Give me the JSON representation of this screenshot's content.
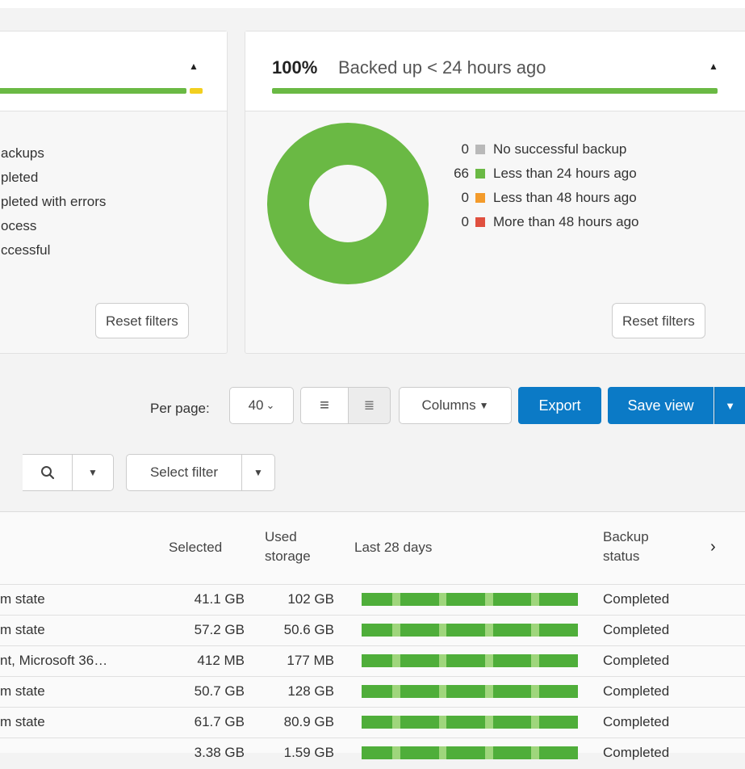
{
  "colors": {
    "green": "#6ab944",
    "yellow": "#f2cf1f",
    "gray": "#b9b9b9",
    "orange": "#f39b2b",
    "red": "#e0503f",
    "blue": "#0b7ac6"
  },
  "left_card": {
    "statuses": [
      "ackups",
      "pleted",
      "pleted with errors",
      "ocess",
      "ccessful"
    ],
    "reset_label": "Reset filters"
  },
  "right_card": {
    "percent": "100%",
    "title": "Backed up < 24 hours ago",
    "reset_label": "Reset filters",
    "donut_fraction_green": 1.0,
    "legend": [
      {
        "count": "0",
        "label": "No successful backup",
        "color": "#b9b9b9"
      },
      {
        "count": "66",
        "label": "Less than 24 hours ago",
        "color": "#6ab944"
      },
      {
        "count": "0",
        "label": "Less than 48 hours ago",
        "color": "#f39b2b"
      },
      {
        "count": "0",
        "label": "More than 48 hours ago",
        "color": "#e0503f"
      }
    ]
  },
  "toolbar": {
    "per_page_label": "Per page:",
    "per_page_value": "40",
    "columns_label": "Columns",
    "export_label": "Export",
    "save_view_label": "Save view"
  },
  "filters": {
    "select_filter_label": "Select filter"
  },
  "table": {
    "headers": {
      "selected": "Selected",
      "used_storage_1": "Used",
      "used_storage_2": "storage",
      "last_28_days": "Last 28 days",
      "backup_status_1": "Backup",
      "backup_status_2": "status"
    },
    "rows": [
      {
        "what": "m state",
        "selected": "41.1 GB",
        "used": "102 GB",
        "status": "Completed"
      },
      {
        "what": "m state",
        "selected": "57.2 GB",
        "used": "50.6 GB",
        "status": "Completed"
      },
      {
        "what": "nt, Microsoft 36…",
        "selected": "412 MB",
        "used": "177 MB",
        "status": "Completed"
      },
      {
        "what": "m state",
        "selected": "50.7 GB",
        "used": "128 GB",
        "status": "Completed"
      },
      {
        "what": "m state",
        "selected": "61.7 GB",
        "used": "80.9 GB",
        "status": "Completed"
      },
      {
        "what": "",
        "selected": "3.38 GB",
        "used": "1.59 GB",
        "status": "Completed"
      }
    ]
  }
}
